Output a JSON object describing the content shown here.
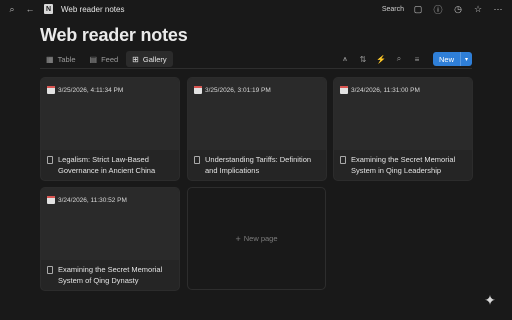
{
  "topbar": {
    "page_icon": "N",
    "breadcrumb": "Web reader notes",
    "search_label": "Search"
  },
  "page": {
    "title": "Web reader notes"
  },
  "views": [
    {
      "label": "Table",
      "icon": "table-icon",
      "active": false
    },
    {
      "label": "Feed",
      "icon": "feed-icon",
      "active": false
    },
    {
      "label": "Gallery",
      "icon": "gallery-icon",
      "active": true
    }
  ],
  "toolbar": {
    "new_label": "New"
  },
  "cards": [
    {
      "date": "3/25/2026, 4:11:34 PM",
      "title": "Legalism: Strict Law-Based Governance in Ancient China"
    },
    {
      "date": "3/25/2026, 3:01:19 PM",
      "title": "Understanding Tariffs: Definition and Implications"
    },
    {
      "date": "3/24/2026, 11:31:00 PM",
      "title": "Examining the Secret Memorial System in Qing Leadership"
    },
    {
      "date": "3/24/2026, 11:30:52 PM",
      "title": "Examining the Secret Memorial System of Qing Dynasty"
    }
  ],
  "new_page_label": "New page",
  "colors": {
    "accent": "#2f7fd8",
    "background": "#191919",
    "card": "#252525"
  }
}
